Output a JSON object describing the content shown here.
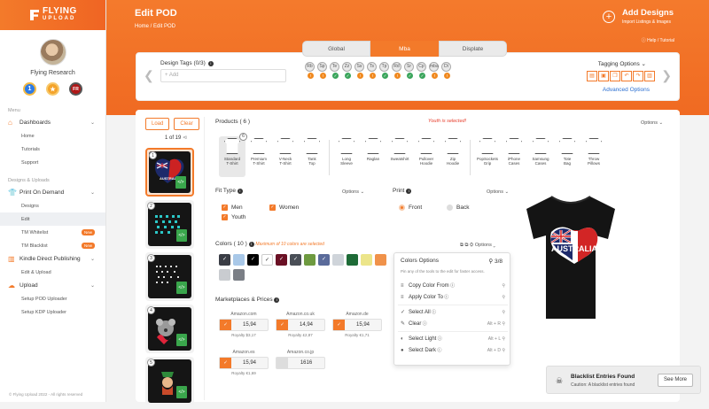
{
  "brand": {
    "line1": "FLYING",
    "line2": "UPLOAD"
  },
  "user": {
    "name": "Flying Research",
    "badges": [
      "1",
      "",
      "FR"
    ]
  },
  "sidebar": {
    "menu_heading": "Menu",
    "dashboards": "Dashboards",
    "dash_items": [
      "Home",
      "Tutorials",
      "Support"
    ],
    "design_heading": "Designs & Uploads",
    "pod": "Print On Demand",
    "pod_items": [
      {
        "label": "Designs",
        "badge": ""
      },
      {
        "label": "Edit",
        "badge": ""
      },
      {
        "label": "TM Whitelist",
        "badge": "New"
      },
      {
        "label": "TM Blacklist",
        "badge": "New"
      }
    ],
    "kdp": "Kindle Direct Publishing",
    "kdp_items": [
      "Edit & Upload"
    ],
    "upload": "Upload",
    "upload_items": [
      "Setup POD Uploader",
      "Setup KDP Uploader"
    ],
    "copyright": "© Flying Upload 2022 - All rights reserved"
  },
  "header": {
    "title": "Edit POD",
    "breadcrumb": "Home  /  Edit POD",
    "add_designs": "Add Designs",
    "add_designs_sub": "Import Listings & Images",
    "help": "Help / Tutorial"
  },
  "tabs": [
    "Global",
    "Mba",
    "Displate"
  ],
  "active_tab": "Mba",
  "tags": {
    "label": "Design Tags (0/3)",
    "placeholder": "+ Add",
    "tagging_options": "Tagging Options",
    "advanced": "Advanced Options",
    "marketplace_icons": [
      "Rb",
      "Sp",
      "Te",
      "Zz",
      "Ss",
      "Ts",
      "Tp",
      "Rd",
      "Sr",
      "Cp",
      "mba",
      "Di"
    ],
    "statuses": [
      "x",
      "x",
      "ok",
      "ok",
      "x",
      "x",
      "ok",
      "x",
      "ok",
      "ok",
      "x",
      "x"
    ]
  },
  "left": {
    "load": "Load",
    "clear": "Clear",
    "counter": "1 of 19",
    "thumb_numbers": [
      "1",
      "2",
      "3",
      "4",
      "5"
    ]
  },
  "products": {
    "heading": "Products ( 6 )",
    "notice": "Youth is selected!",
    "options": "Options",
    "items": [
      {
        "l1": "Standard",
        "l2": "T-Shirt",
        "selected": true,
        "count": "6"
      },
      {
        "l1": "Premium",
        "l2": "T-Shirt"
      },
      {
        "l1": "V-Neck",
        "l2": "T-Shirt"
      },
      {
        "l1": "Tank",
        "l2": "Top"
      },
      {
        "l1": "Long",
        "l2": "Sleeve"
      },
      {
        "l1": "Raglan",
        "l2": ""
      },
      {
        "l1": "Sweatshirt",
        "l2": ""
      },
      {
        "l1": "Pullover",
        "l2": "Hoodie"
      },
      {
        "l1": "Zip",
        "l2": "Hoodie"
      },
      {
        "l1": "PopSockets",
        "l2": "Grip"
      },
      {
        "l1": "iPhone",
        "l2": "Cases"
      },
      {
        "l1": "Samsung",
        "l2": "Cases"
      },
      {
        "l1": "Tote",
        "l2": "Bag"
      },
      {
        "l1": "Throw",
        "l2": "Pillows"
      }
    ]
  },
  "fit": {
    "heading": "Fit Type",
    "options": "Options",
    "men": "Men",
    "women": "Women",
    "youth": "Youth"
  },
  "print": {
    "heading": "Print",
    "options": "Options",
    "front": "Front",
    "back": "Back"
  },
  "colors": {
    "heading": "Colors ( 10 )",
    "limit": "Maximum of 10 colors are selected",
    "options": "Options",
    "swatches": [
      {
        "c": "#3a3d45",
        "on": true
      },
      {
        "c": "#a9c8e8",
        "on": false
      },
      {
        "c": "#000000",
        "on": true
      },
      {
        "c": "#ffffff",
        "on": true
      },
      {
        "c": "#6a1024",
        "on": true
      },
      {
        "c": "#4a4f57",
        "on": true
      },
      {
        "c": "#6e9a40",
        "on": false
      },
      {
        "c": "#5a6b9a",
        "on": true
      },
      {
        "c": "#cfd4da",
        "on": false
      },
      {
        "c": "#1e6b37",
        "on": false
      },
      {
        "c": "#ece58a",
        "on": false
      },
      {
        "c": "#f0924a",
        "on": false
      },
      {
        "c": "#c9ccd0",
        "on": false
      },
      {
        "c": "#7b7f86",
        "on": false
      }
    ]
  },
  "color_options": {
    "title": "Colors Options",
    "count": "3/8",
    "desc": "Pin any of the tools to the edit for faster access.",
    "items": [
      {
        "icon": "≡",
        "label": "Copy Color From",
        "shortcut": ""
      },
      {
        "icon": "≡",
        "label": "Apply Color To",
        "shortcut": ""
      },
      {
        "icon": "✓",
        "label": "Select All",
        "shortcut": ""
      },
      {
        "icon": "✎",
        "label": "Clear",
        "shortcut": "Alt + R"
      },
      {
        "icon": "◐",
        "label": "Select Light",
        "shortcut": "Alt + L"
      },
      {
        "icon": "●",
        "label": "Select Dark",
        "shortcut": "Alt + D"
      }
    ]
  },
  "prices": {
    "heading": "Marketplaces & Prices",
    "items": [
      {
        "mk": "Amazon.com",
        "val": "15,94",
        "roy": "Royalty $3,17",
        "on": true
      },
      {
        "mk": "Amazon.co.uk",
        "val": "14,94",
        "roy": "Royalty £2,87",
        "on": true
      },
      {
        "mk": "Amazon.de",
        "val": "15,94",
        "roy": "Royalty €1,71",
        "on": true
      },
      {
        "mk": "Amazon.es",
        "val": "15,94",
        "roy": "Royalty €1,69",
        "on": true
      },
      {
        "mk": "Amazon.co.jp",
        "val": "1616",
        "roy": "",
        "on": false
      }
    ]
  },
  "preview": {
    "text": "AUSTRALIA"
  },
  "toast": {
    "title": "Blacklist Entries Found",
    "msg": "Caution: A blacklist entries found",
    "btn": "See More"
  }
}
